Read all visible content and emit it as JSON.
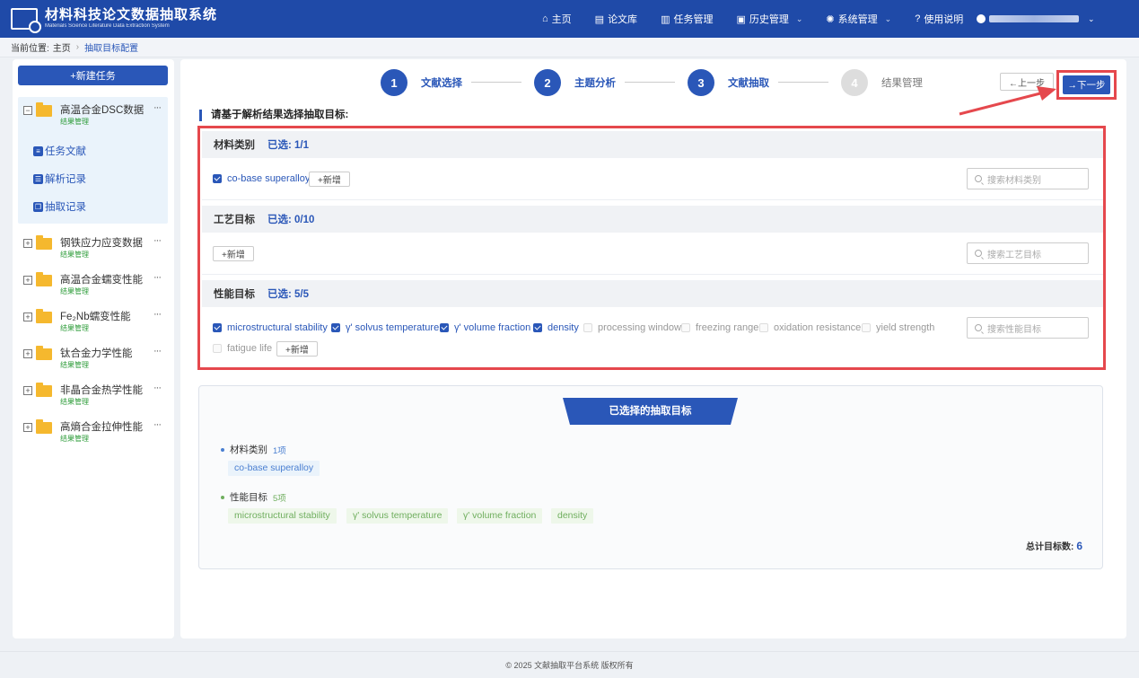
{
  "header": {
    "title": "材料科技论文数据抽取系统",
    "subtitle": "Materials Science Literature Data Extraction System",
    "nav": [
      {
        "label": "主页",
        "icon": "home-icon",
        "glyph": "⌂"
      },
      {
        "label": "论文库",
        "icon": "book-icon",
        "glyph": "▤"
      },
      {
        "label": "任务管理",
        "icon": "tasks-icon",
        "glyph": "▥"
      },
      {
        "label": "历史管理",
        "icon": "history-icon",
        "glyph": "▣"
      },
      {
        "label": "系统管理",
        "icon": "gear-icon",
        "glyph": "✺"
      },
      {
        "label": "使用说明",
        "icon": "help-icon",
        "glyph": "?"
      }
    ]
  },
  "breadcrumb": {
    "prefix": "当前位置:",
    "home": "主页",
    "current": "抽取目标配置"
  },
  "sidebar": {
    "new_task": "+新建任务",
    "tasks": [
      {
        "name": "高温合金DSC数据",
        "sub": "结果管理"
      },
      {
        "name": "钢铁应力应变数据",
        "sub": "结果管理"
      },
      {
        "name": "高温合金蠕变性能",
        "sub": "结果管理"
      },
      {
        "name": "Fe₂Nb蠕变性能",
        "sub": "结果管理"
      },
      {
        "name": "钛合金力学性能",
        "sub": "结果管理"
      },
      {
        "name": "非晶合金热学性能",
        "sub": "结果管理"
      },
      {
        "name": "高熵合金拉伸性能",
        "sub": "结果管理"
      }
    ],
    "subitems": [
      "任务文献",
      "解析记录",
      "抽取记录"
    ],
    "more": "···",
    "expanded": "−",
    "collapsed": "+"
  },
  "steps": [
    {
      "num": "1",
      "label": "文献选择"
    },
    {
      "num": "2",
      "label": "主题分析"
    },
    {
      "num": "3",
      "label": "文献抽取"
    },
    {
      "num": "4",
      "label": "结果管理"
    }
  ],
  "buttons": {
    "prev": "←上一步",
    "next": "→下一步",
    "add": "+新增"
  },
  "section_title": "请基于解析结果选择抽取目标:",
  "groups": {
    "material": {
      "title": "材料类别",
      "count": "已选: 1/1",
      "items": [
        {
          "label": "co-base superalloy",
          "checked": true
        }
      ],
      "search_placeholder": "搜索材料类别"
    },
    "process": {
      "title": "工艺目标",
      "count": "已选: 0/10",
      "search_placeholder": "搜索工艺目标"
    },
    "property": {
      "title": "性能目标",
      "count": "已选: 5/5",
      "items": [
        {
          "label": "microstructural stability",
          "checked": true
        },
        {
          "label": "γ' solvus temperature",
          "checked": true
        },
        {
          "label": "γ' volume fraction",
          "checked": true
        },
        {
          "label": "density",
          "checked": true
        },
        {
          "label": "processing window",
          "checked": false
        },
        {
          "label": "freezing range",
          "checked": false
        },
        {
          "label": "oxidation resistance",
          "checked": false
        },
        {
          "label": "yield strength",
          "checked": false
        },
        {
          "label": "fatigue life",
          "checked": false
        }
      ],
      "search_placeholder": "搜索性能目标"
    }
  },
  "summary": {
    "title": "已选择的抽取目标",
    "material_label": "材料类别",
    "material_count": "1项",
    "material_tags": [
      "co-base superalloy"
    ],
    "property_label": "性能目标",
    "property_count": "5项",
    "property_tags": [
      "microstructural stability",
      "γ' solvus temperature",
      "γ' volume fraction",
      "density"
    ],
    "total_label": "总计目标数:",
    "total_value": "6"
  },
  "footer": "© 2025 文献抽取平台系统 版权所有",
  "colors": {
    "primary": "#2a57b8",
    "header": "#1f4aa8",
    "highlight": "#e5484d"
  }
}
